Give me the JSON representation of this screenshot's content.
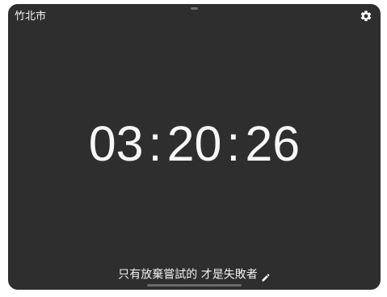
{
  "location": "竹北市",
  "clock": {
    "hours": "03",
    "minutes": "20",
    "seconds": "26",
    "separator": ":"
  },
  "quote": "只有放棄嘗試的 才是失敗者",
  "icons": {
    "settings": "gear-icon",
    "edit": "pencil-icon"
  },
  "colors": {
    "background": "#2e2e2e",
    "text": "#ffffff"
  }
}
